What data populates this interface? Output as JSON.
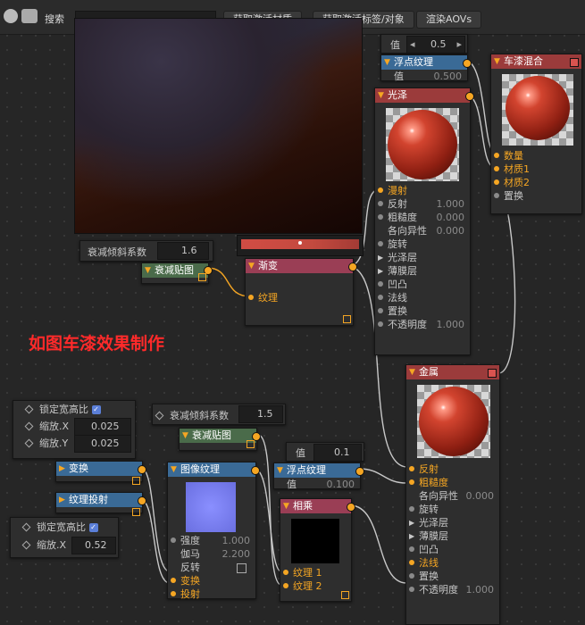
{
  "toolbar": {
    "search_label": "搜索",
    "btn_fetch_material": "获取激活材质",
    "btn_fetch_tag": "获取激活标签/对象",
    "btn_render_aov": "渲染AOVs"
  },
  "annotation": "如图车漆效果制作",
  "value_node_top": {
    "label": "值",
    "value": "0.5"
  },
  "float_tex_top": {
    "title": "浮点纹理",
    "sub_label": "值",
    "sub_value": "0.500"
  },
  "car_paint_mix": {
    "title": "车漆混合",
    "inputs": [
      "数量",
      "材质1",
      "材质2",
      "置换"
    ]
  },
  "gloss": {
    "title": "光泽",
    "rows": [
      {
        "label": "漫射",
        "value": ""
      },
      {
        "label": "反射",
        "value": "1.000"
      },
      {
        "label": "粗糙度",
        "value": "0.000"
      },
      {
        "label": "各向异性",
        "value": "0.000"
      },
      {
        "label": "旋转",
        "value": ""
      },
      {
        "label": "光泽层",
        "value": ""
      },
      {
        "label": "薄膜层",
        "value": ""
      },
      {
        "label": "凹凸",
        "value": ""
      },
      {
        "label": "法线",
        "value": ""
      },
      {
        "label": "置换",
        "value": ""
      },
      {
        "label": "不透明度",
        "value": "1.000"
      }
    ]
  },
  "falloff_top": {
    "param_label": "衰减倾斜系数",
    "param_value": "1.6",
    "node_title": "衰减贴图"
  },
  "gradient": {
    "title": "渐变",
    "input": "纹理"
  },
  "metal": {
    "title": "金属",
    "rows": [
      {
        "label": "反射",
        "value": ""
      },
      {
        "label": "粗糙度",
        "value": ""
      },
      {
        "label": "各向异性",
        "value": "0.000"
      },
      {
        "label": "旋转",
        "value": ""
      },
      {
        "label": "光泽层",
        "value": ""
      },
      {
        "label": "薄膜层",
        "value": ""
      },
      {
        "label": "凹凸",
        "value": ""
      },
      {
        "label": "法线",
        "value": ""
      },
      {
        "label": "置换",
        "value": ""
      },
      {
        "label": "不透明度",
        "value": "1.000"
      }
    ]
  },
  "lock_panel_1": {
    "lock_label": "锁定宽高比",
    "scale_x_label": "缩放.X",
    "scale_x": "0.025",
    "scale_y_label": "缩放.Y",
    "scale_y": "0.025"
  },
  "falloff_bottom": {
    "param_label": "衰减倾斜系数",
    "param_value": "1.5",
    "node_title": "衰减贴图"
  },
  "value_node_bottom": {
    "label": "值",
    "value": "0.1"
  },
  "float_tex_bottom": {
    "title": "浮点纹理",
    "sub_label": "值",
    "sub_value": "0.100"
  },
  "transform": {
    "title": "变换"
  },
  "tex_projection": {
    "title": "纹理投射"
  },
  "image_tex": {
    "title": "图像纹理",
    "rows": [
      {
        "label": "强度",
        "value": "1.000"
      },
      {
        "label": "伽马",
        "value": "2.200"
      },
      {
        "label": "反转",
        "value": ""
      },
      {
        "label": "变换",
        "value": ""
      },
      {
        "label": "投射",
        "value": ""
      }
    ]
  },
  "multiply": {
    "title": "相乘",
    "inputs": [
      "纹理 1",
      "纹理 2"
    ]
  },
  "lock_panel_2": {
    "lock_label": "锁定宽高比",
    "scale_x_label": "缩放.X",
    "scale_x": "0.52"
  },
  "colors": {
    "accent": "#f5a623",
    "annotation": "#ff2a2a",
    "material_header": "#9b3b3b",
    "texture_header": "#3a6a96"
  }
}
